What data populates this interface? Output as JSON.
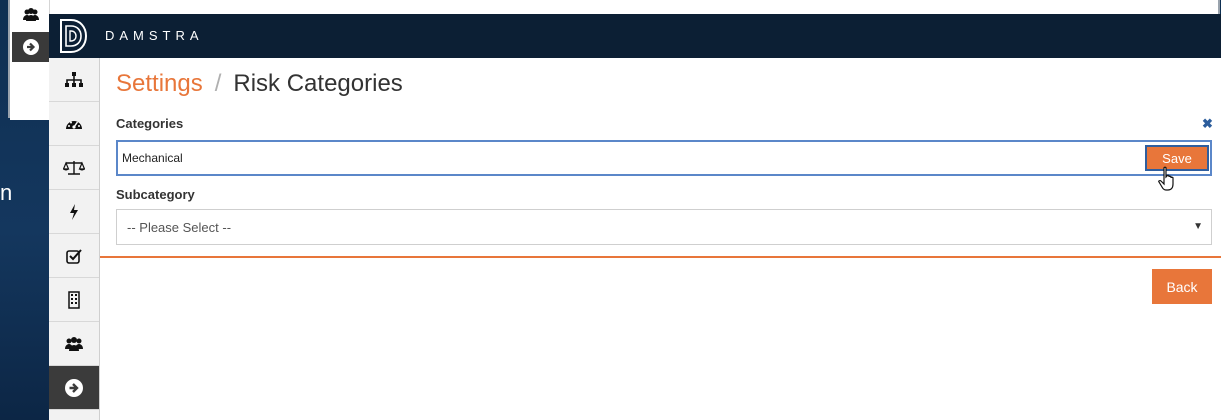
{
  "app": {
    "brand": "DAMSTRA"
  },
  "backdrop": {
    "partial_text": "n"
  },
  "breadcrumb": {
    "parent": "Settings",
    "separator": "/",
    "current": "Risk Categories"
  },
  "form": {
    "categories_label": "Categories",
    "category_value": "Mechanical",
    "save_label": "Save",
    "close_glyph": "✖",
    "subcategory_label": "Subcategory",
    "subcategory_selected": "-- Please Select --",
    "back_label": "Back"
  },
  "sidebar": {
    "items": [
      {
        "icon": "sitemap-icon"
      },
      {
        "icon": "dashboard-icon"
      },
      {
        "icon": "balance-scale-icon"
      },
      {
        "icon": "bolt-icon"
      },
      {
        "icon": "checkbox-icon"
      },
      {
        "icon": "building-icon"
      },
      {
        "icon": "users-icon"
      },
      {
        "icon": "arrow-circle-right-icon",
        "active": true
      }
    ]
  },
  "colors": {
    "accent": "#e8763a",
    "topbar": "#0c1f34",
    "focus": "#5b87c9"
  }
}
